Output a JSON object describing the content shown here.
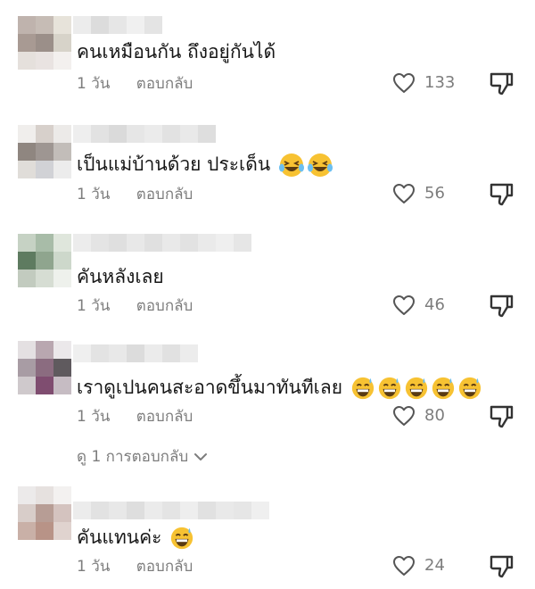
{
  "comments": [
    {
      "text": "คนเหมือนกัน ถึงอยู่กันได้",
      "time": "1 วัน",
      "reply": "ตอบกลับ",
      "likes": "133",
      "emojis": []
    },
    {
      "text": "เป็นแม่บ้านด้วย ประเด็น",
      "time": "1 วัน",
      "reply": "ตอบกลับ",
      "likes": "56",
      "emojis": [
        "laughing-tears",
        "laughing-tears"
      ]
    },
    {
      "text": "คันหลังเลย",
      "time": "1 วัน",
      "reply": "ตอบกลับ",
      "likes": "46",
      "emojis": []
    },
    {
      "text": "เราดูเปนคนสะอาดขึ้นมาทันทีเลย",
      "time": "1 วัน",
      "reply": "ตอบกลับ",
      "likes": "80",
      "emojis": [
        "grin-sweat",
        "grin-sweat",
        "grin-sweat",
        "grin-sweat",
        "grin-sweat"
      ]
    },
    {
      "text": "คันแทนค่ะ",
      "time": "1 วัน",
      "reply": "ตอบกลับ",
      "likes": "24",
      "emojis": [
        "grin-sweat"
      ]
    }
  ],
  "view_replies": "ดู 1 การตอบกลับ",
  "icons": {
    "like": "heart-outline-icon",
    "dislike": "thumbs-down-icon",
    "expand": "chevron-down-icon"
  },
  "colors": {
    "text": "#161616",
    "meta": "#7d7d7d",
    "emoji_face": "#f7c232"
  }
}
